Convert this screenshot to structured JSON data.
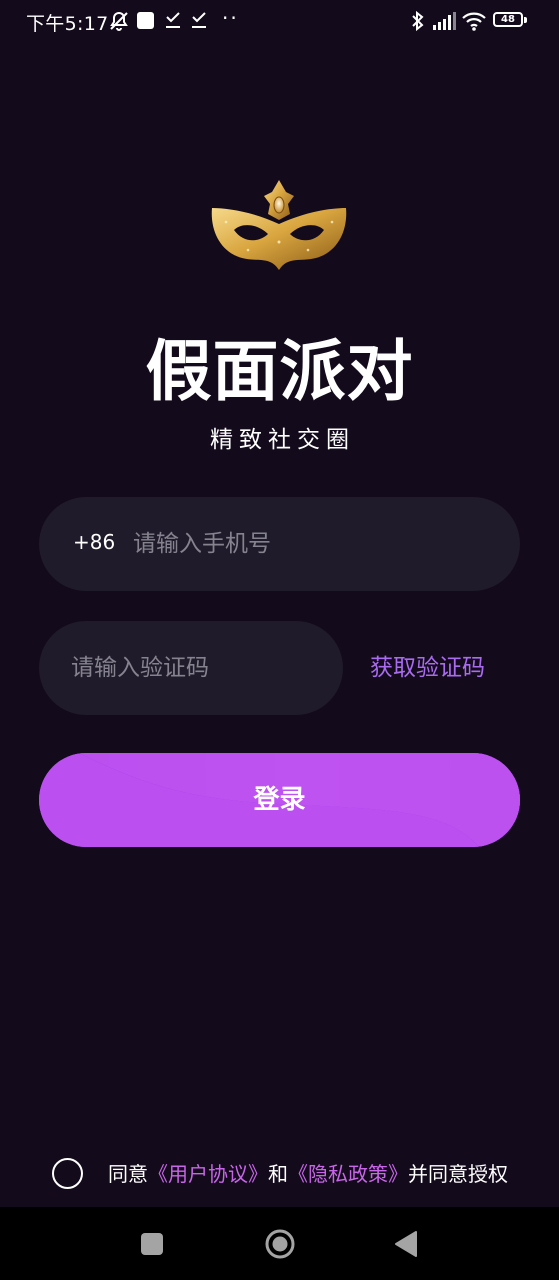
{
  "status_bar": {
    "time": "下午5:17",
    "battery": "48"
  },
  "app": {
    "title": "假面派对",
    "subtitle": "精致社交圈",
    "logo_icon": "golden-mask-icon"
  },
  "form": {
    "country_code": "+86",
    "phone_placeholder": "请输入手机号",
    "phone_value": "",
    "code_placeholder": "请输入验证码",
    "code_value": "",
    "get_code_label": "获取验证码",
    "login_label": "登录"
  },
  "agreement": {
    "prefix": "同意",
    "user_agreement": "《用户协议》",
    "conjunction": "和",
    "privacy_policy": "《隐私政策》",
    "suffix": "并同意授权",
    "checked": false
  },
  "colors": {
    "background": "#130a1c",
    "field_background": "#1f1b2a",
    "accent_link": "#a96bf0",
    "button": "#bb4ff0",
    "agreement_link": "#c865e8"
  }
}
